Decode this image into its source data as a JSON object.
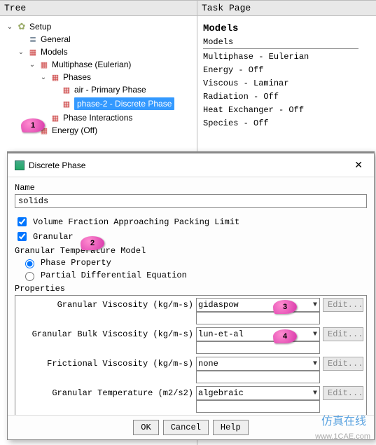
{
  "panes": {
    "tree_header": "Tree",
    "task_header": "Task Page"
  },
  "tree": {
    "setup": "Setup",
    "general": "General",
    "models": "Models",
    "multiphase": "Multiphase (Eulerian)",
    "phases": "Phases",
    "air": "air - Primary Phase",
    "phase2": "phase-2 - Discrete Phase",
    "interactions": "Phase Interactions",
    "energy": "Energy (Off)"
  },
  "task": {
    "heading": "Models",
    "sub": "Models",
    "items": [
      "Multiphase - Eulerian",
      "Energy - Off",
      "Viscous - Laminar",
      "Radiation - Off",
      "Heat Exchanger - Off",
      "Species - Off"
    ]
  },
  "dialog": {
    "title": "Discrete Phase",
    "name_label": "Name",
    "name_value": "solids",
    "chk_vfrac": "Volume Fraction Approaching Packing Limit",
    "chk_granular": "Granular",
    "gtm_label": "Granular Temperature Model",
    "radio_phaseprop": "Phase Property",
    "radio_pde": "Partial Differential Equation",
    "props_label": "Properties",
    "rows": {
      "gran_visc": {
        "label": "Granular Viscosity (kg/m-s)",
        "value": "gidaspow",
        "edit": "Edit..."
      },
      "bulk_visc": {
        "label": "Granular Bulk Viscosity (kg/m-s)",
        "value": "lun-et-al",
        "edit": "Edit..."
      },
      "fric_visc": {
        "label": "Frictional Viscosity (kg/m-s)",
        "value": "none",
        "edit": "Edit..."
      },
      "gran_temp": {
        "label": "Granular Temperature (m2/s2)",
        "value": "algebraic",
        "edit": "Edit..."
      }
    },
    "buttons": {
      "ok": "OK",
      "cancel": "Cancel",
      "help": "Help"
    }
  },
  "callouts": {
    "c1": "1",
    "c2": "2",
    "c3": "3",
    "c4": "4"
  },
  "watermark": {
    "line1": "仿真在线",
    "line2": "www.1CAE.com"
  }
}
